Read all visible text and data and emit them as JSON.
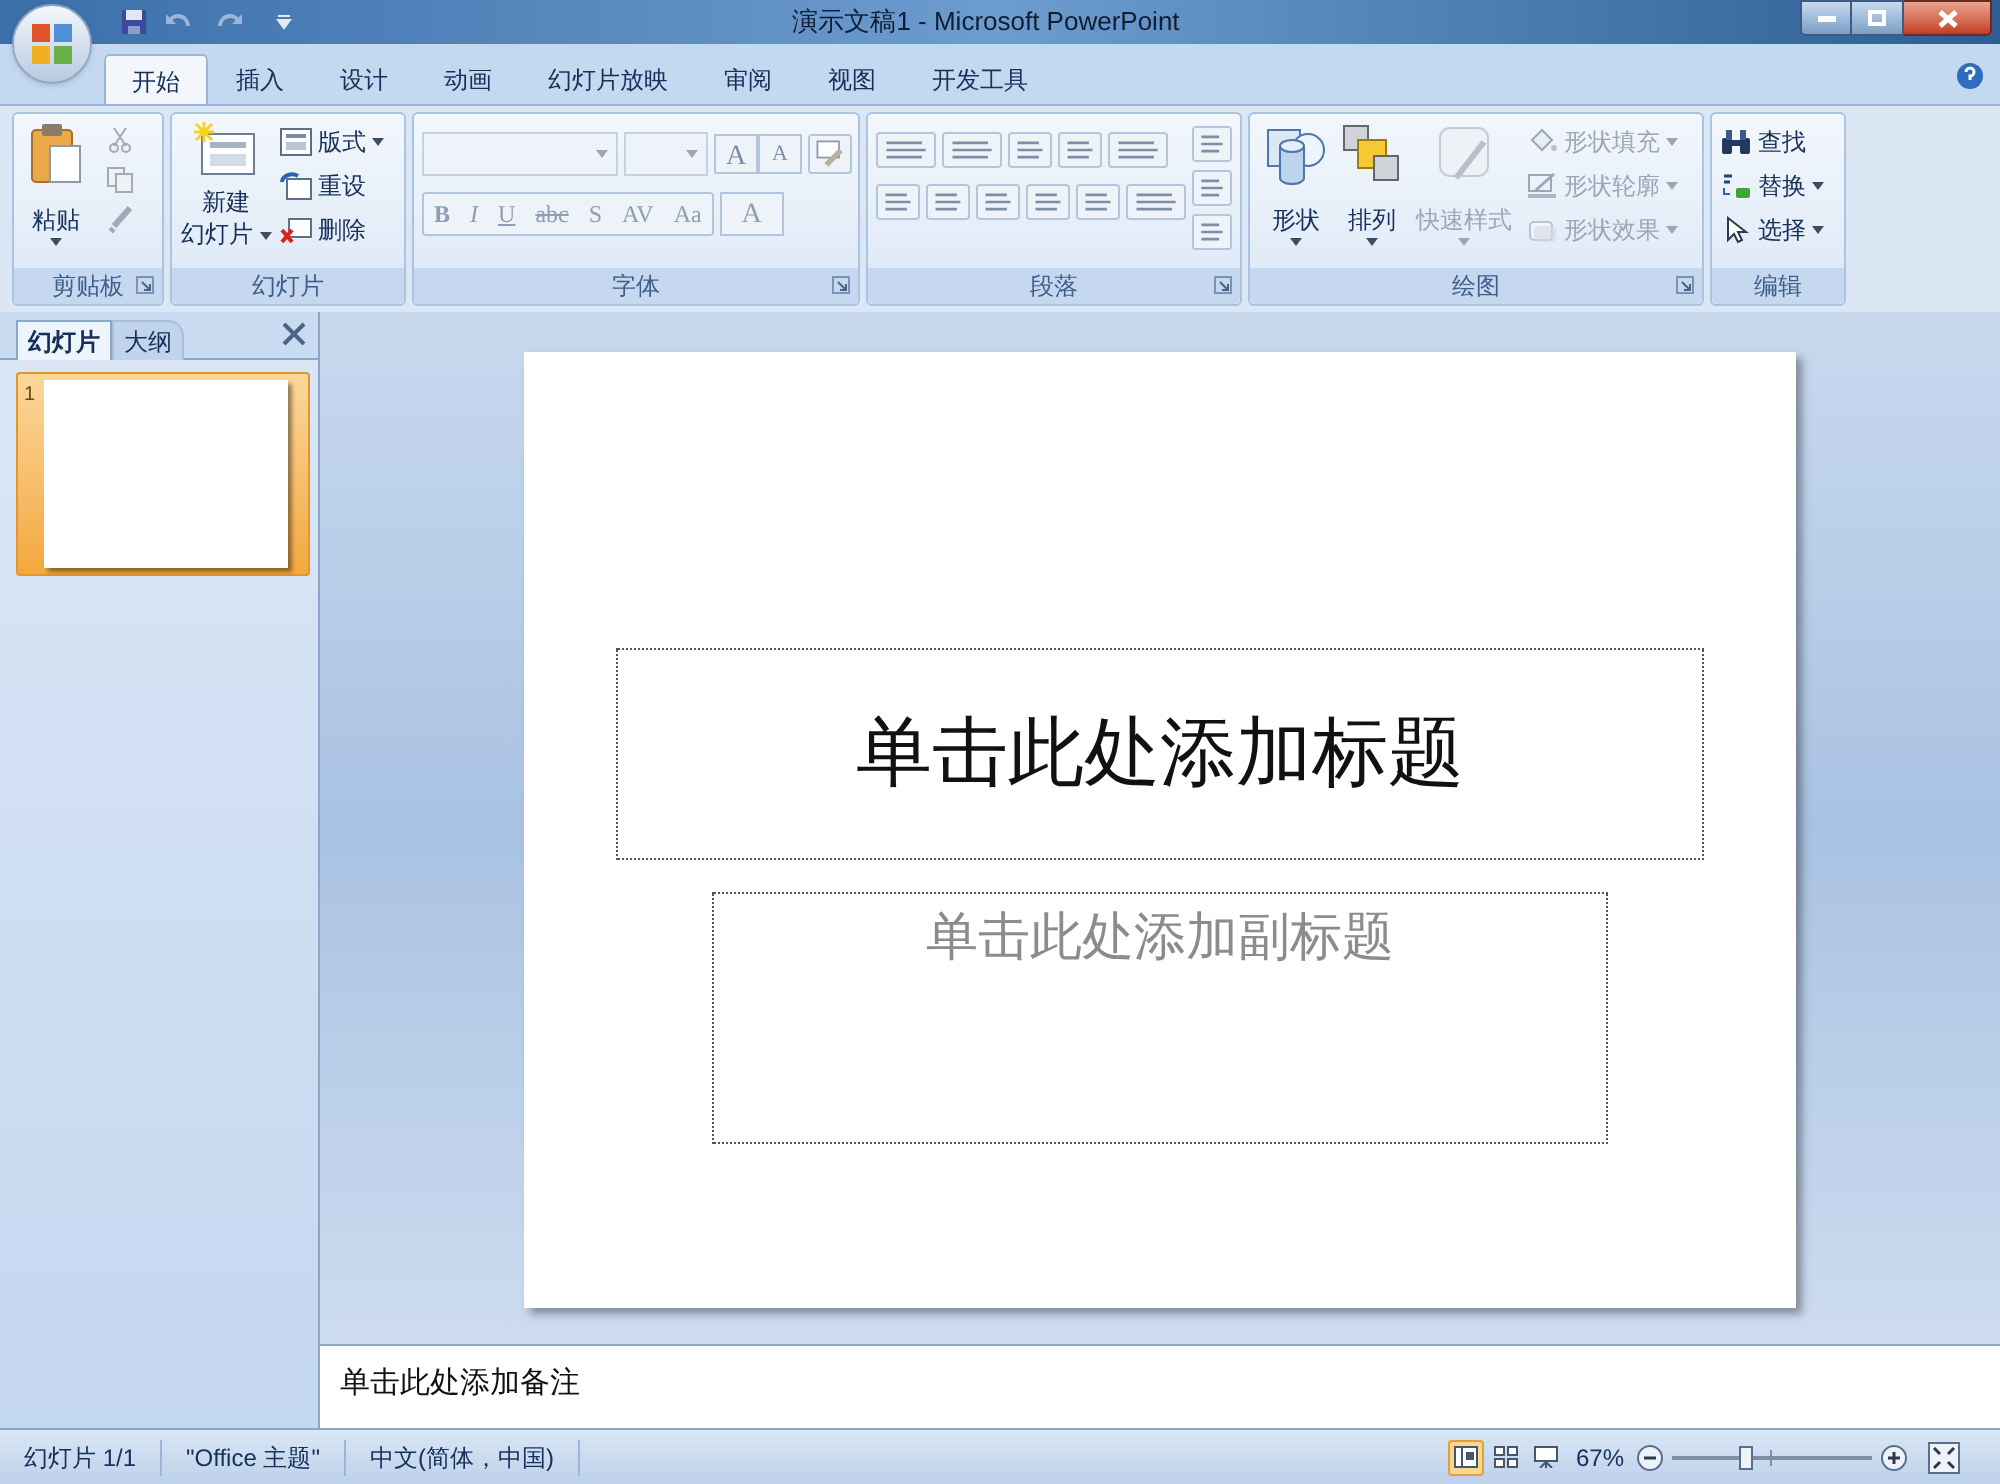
{
  "window": {
    "title": "演示文稿1 - Microsoft PowerPoint"
  },
  "tabs": [
    {
      "label": "开始",
      "selected": true
    },
    {
      "label": "插入",
      "selected": false
    },
    {
      "label": "设计",
      "selected": false
    },
    {
      "label": "动画",
      "selected": false
    },
    {
      "label": "幻灯片放映",
      "selected": false
    },
    {
      "label": "审阅",
      "selected": false
    },
    {
      "label": "视图",
      "selected": false
    },
    {
      "label": "开发工具",
      "selected": false
    }
  ],
  "ribbon": {
    "clipboard": {
      "label": "剪贴板",
      "paste": {
        "label": "粘贴"
      }
    },
    "slides": {
      "label": "幻灯片",
      "new_slide": {
        "label": "新建",
        "label_2": "幻灯片"
      },
      "small_buttons": [
        {
          "kind": "layout",
          "label": "版式",
          "dropdown": true
        },
        {
          "kind": "reset",
          "label": "重设",
          "dropdown": false
        },
        {
          "kind": "delete",
          "label": "删除",
          "dropdown": false
        }
      ]
    },
    "font": {
      "label": "字体",
      "size_buttons": [
        {
          "label": "A"
        },
        {
          "label": "A"
        }
      ],
      "format_buttons": [
        {
          "label": "B",
          "disabled": true
        },
        {
          "label": "I",
          "disabled": true
        },
        {
          "label": "U",
          "disabled": true
        },
        {
          "label": "abc",
          "disabled": true
        },
        {
          "label": "S",
          "disabled": true
        },
        {
          "label": "AV",
          "disabled": true
        },
        {
          "label": "Aa",
          "disabled": true
        }
      ],
      "color_button": {
        "label": "A"
      }
    },
    "paragraph": {
      "label": "段落"
    },
    "drawing": {
      "label": "绘图",
      "large_buttons": [
        {
          "kind": "shapes",
          "label": "形状",
          "disabled": false
        },
        {
          "kind": "arrange",
          "label": "排列",
          "disabled": false
        },
        {
          "kind": "quick_styles",
          "label": "快速样式",
          "disabled": true
        }
      ],
      "small_buttons": [
        {
          "kind": "fill",
          "label": "形状填充",
          "disabled": true
        },
        {
          "kind": "outline",
          "label": "形状轮廓",
          "disabled": true
        },
        {
          "kind": "effects",
          "label": "形状效果",
          "disabled": true
        }
      ]
    },
    "editing": {
      "label": "编辑",
      "buttons": [
        {
          "kind": "find",
          "label": "查找",
          "dropdown": false
        },
        {
          "kind": "replace",
          "label": "替换",
          "dropdown": true
        },
        {
          "kind": "select",
          "label": "选择",
          "dropdown": true
        }
      ]
    }
  },
  "side_pane": {
    "tabs": [
      {
        "label": "幻灯片",
        "selected": true
      },
      {
        "label": "大纲",
        "selected": false
      }
    ],
    "thumbnails": [
      {
        "number": "1",
        "selected": true
      }
    ]
  },
  "slide": {
    "title_placeholder": "单击此处添加标题",
    "subtitle_placeholder": "单击此处添加副标题"
  },
  "notes": {
    "placeholder": "单击此处添加备注"
  },
  "status_bar": {
    "items": [
      "幻灯片 1/1",
      "\"Office 主题\"",
      "中文(简体，中国)"
    ],
    "views": [
      {
        "kind": "normal",
        "selected": true
      },
      {
        "kind": "sorter",
        "selected": false
      },
      {
        "kind": "show",
        "selected": false
      }
    ],
    "zoom": "67%",
    "zoom_slider": {
      "level": 0.37
    }
  }
}
